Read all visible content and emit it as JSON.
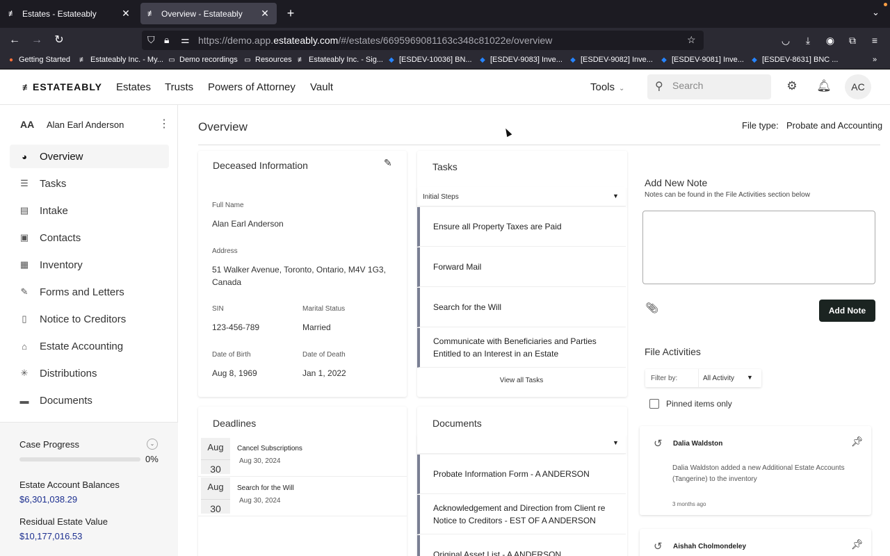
{
  "browser": {
    "tabs": [
      {
        "title": "Estates - Estateably",
        "favicon": "estateably-icon"
      },
      {
        "title": "Overview - Estateably",
        "favicon": "estateably-icon",
        "active": true
      }
    ],
    "url_prefix": "https://demo.app.",
    "url_domain": "estateably.com",
    "url_path": "/#/estates/6695969081163c348c81022e/overview",
    "bookmarks": [
      {
        "label": "Getting Started",
        "icon": "firefox-icon"
      },
      {
        "label": "Estateably Inc. - My...",
        "icon": "estateably-icon"
      },
      {
        "label": "Demo recordings",
        "icon": "folder-icon"
      },
      {
        "label": "Resources",
        "icon": "folder-icon"
      },
      {
        "label": "Estateably Inc. - Sig...",
        "icon": "estateably-icon"
      },
      {
        "label": "[ESDEV-10036] BN...",
        "icon": "jira-icon"
      },
      {
        "label": "[ESDEV-9083] Inve...",
        "icon": "jira-icon"
      },
      {
        "label": "[ESDEV-9082] Inve...",
        "icon": "jira-icon"
      },
      {
        "label": "[ESDEV-9081] Inve...",
        "icon": "jira-icon"
      },
      {
        "label": "[ESDEV-8631] BNC ...",
        "icon": "jira-icon"
      }
    ]
  },
  "header": {
    "logo": "ESTATEABLY",
    "nav": [
      "Estates",
      "Trusts",
      "Powers of Attorney",
      "Vault"
    ],
    "tools": "Tools",
    "search_placeholder": "Search",
    "avatar": "AC"
  },
  "sidebar": {
    "user_initials": "AA",
    "user_name": "Alan Earl Anderson",
    "items": [
      {
        "label": "Overview",
        "icon": "overview-icon",
        "active": true
      },
      {
        "label": "Tasks",
        "icon": "tasks-icon"
      },
      {
        "label": "Intake",
        "icon": "intake-icon"
      },
      {
        "label": "Contacts",
        "icon": "contacts-icon"
      },
      {
        "label": "Inventory",
        "icon": "inventory-icon"
      },
      {
        "label": "Forms and Letters",
        "icon": "forms-icon"
      },
      {
        "label": "Notice to Creditors",
        "icon": "clipboard-icon"
      },
      {
        "label": "Estate Accounting",
        "icon": "bank-icon"
      },
      {
        "label": "Distributions",
        "icon": "distributions-icon"
      },
      {
        "label": "Documents",
        "icon": "folder-icon"
      }
    ],
    "case_progress_label": "Case Progress",
    "case_progress_value": 0,
    "case_progress_text": "0%",
    "balances_label": "Estate Account Balances",
    "balances_value": "$6,301,038.29",
    "residual_label": "Residual Estate Value",
    "residual_value": "$10,177,016.53"
  },
  "main": {
    "title": "Overview",
    "file_type_label": "File type:",
    "file_type_value": "Probate and Accounting",
    "deceased": {
      "title": "Deceased Information",
      "full_name_label": "Full Name",
      "full_name": "Alan Earl Anderson",
      "address_label": "Address",
      "address_line1": "51 Walker Avenue, Toronto, Ontario, M4V 1G3,",
      "address_line2": "Canada",
      "sin_label": "SIN",
      "sin": "123-456-789",
      "marital_label": "Marital Status",
      "marital": "Married",
      "dob_label": "Date of Birth",
      "dob": "Aug 8, 1969",
      "dod_label": "Date of Death",
      "dod": "Jan 1, 2022"
    },
    "tasks": {
      "title": "Tasks",
      "select_value": "Initial Steps",
      "items": [
        "Ensure all Property Taxes are Paid",
        "Forward Mail",
        "Search for the Will",
        "Communicate with Beneficiaries and Parties Entitled to an Interest in an Estate"
      ],
      "view_all": "View all Tasks"
    },
    "deadlines": {
      "title": "Deadlines",
      "items": [
        {
          "month": "Aug",
          "day": "30",
          "title": "Cancel Subscriptions",
          "date": "Aug 30, 2024"
        },
        {
          "month": "Aug",
          "day": "30",
          "title": "Search for the Will",
          "date": "Aug 30, 2024"
        }
      ]
    },
    "documents": {
      "title": "Documents",
      "items": [
        "Probate Information Form - A ANDERSON",
        "Acknowledgement and Direction from Client re Notice to Creditors - EST OF A ANDERSON",
        "Original Asset List - A ANDERSON"
      ]
    },
    "note": {
      "title": "Add New Note",
      "hint": "Notes can be found in the File Activities section below",
      "button": "Add Note"
    },
    "activities": {
      "title": "File Activities",
      "filter_label": "Filter by:",
      "filter_value": "All Activity",
      "pinned_label": "Pinned items only",
      "items": [
        {
          "who": "Dalia Waldston",
          "msg": "Dalia Waldston added a new Additional Estate Accounts (Tangerine) to the inventory",
          "when": "3 months ago"
        },
        {
          "who": "Aishah Cholmondeley",
          "msg": "",
          "when": ""
        }
      ]
    }
  }
}
